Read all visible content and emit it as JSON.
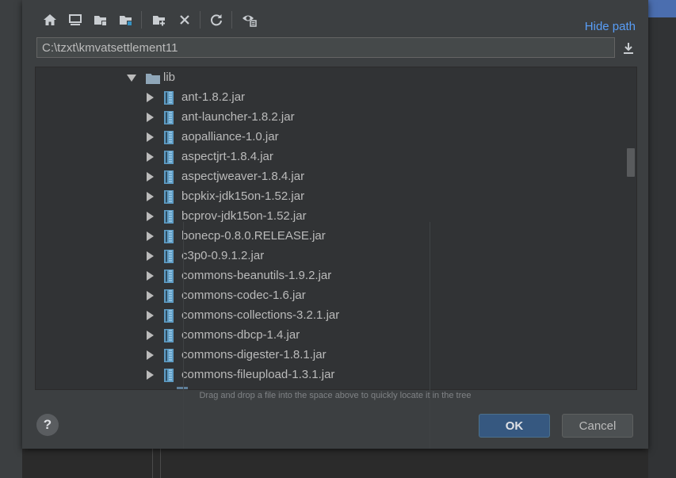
{
  "toolbar": {
    "buttons": [
      {
        "icon": "home-icon"
      },
      {
        "icon": "desktop-icon"
      },
      {
        "icon": "project-folder-icon"
      },
      {
        "icon": "module-folder-icon"
      },
      {
        "icon": "new-folder-icon"
      },
      {
        "icon": "delete-icon"
      },
      {
        "icon": "refresh-icon"
      },
      {
        "icon": "show-hidden-files-icon"
      }
    ],
    "hide_path_label": "Hide path"
  },
  "path": {
    "value": "C:\\tzxt\\kmvatsettlement11",
    "download_icon": "download-icon"
  },
  "tree": {
    "folder": {
      "label": "lib",
      "expanded": true,
      "icon": "folder-icon"
    },
    "items": [
      {
        "label": "ant-1.8.2.jar",
        "icon": "jar-icon"
      },
      {
        "label": "ant-launcher-1.8.2.jar",
        "icon": "jar-icon"
      },
      {
        "label": "aopalliance-1.0.jar",
        "icon": "jar-icon"
      },
      {
        "label": "aspectjrt-1.8.4.jar",
        "icon": "jar-icon"
      },
      {
        "label": "aspectjweaver-1.8.4.jar",
        "icon": "jar-icon"
      },
      {
        "label": "bcpkix-jdk15on-1.52.jar",
        "icon": "jar-icon"
      },
      {
        "label": "bcprov-jdk15on-1.52.jar",
        "icon": "jar-icon"
      },
      {
        "label": "bonecp-0.8.0.RELEASE.jar",
        "icon": "jar-icon"
      },
      {
        "label": "c3p0-0.9.1.2.jar",
        "icon": "jar-icon"
      },
      {
        "label": "commons-beanutils-1.9.2.jar",
        "icon": "jar-icon"
      },
      {
        "label": "commons-codec-1.6.jar",
        "icon": "jar-icon"
      },
      {
        "label": "commons-collections-3.2.1.jar",
        "icon": "jar-icon"
      },
      {
        "label": "commons-dbcp-1.4.jar",
        "icon": "jar-icon"
      },
      {
        "label": "commons-digester-1.8.1.jar",
        "icon": "jar-icon"
      },
      {
        "label": "commons-fileupload-1.3.1.jar",
        "icon": "jar-icon"
      }
    ]
  },
  "hint": "Drag and drop a file into the space above to quickly locate it in the tree",
  "buttons": {
    "help_label": "?",
    "ok_label": "OK",
    "cancel_label": "Cancel"
  },
  "colors": {
    "dialog_bg": "#3c3f41",
    "tree_bg": "#313335",
    "accent_link": "#589df6",
    "ok_bg": "#365880",
    "jar_icon": "#6fb0d9",
    "folder_icon": "#8fa6b8"
  }
}
